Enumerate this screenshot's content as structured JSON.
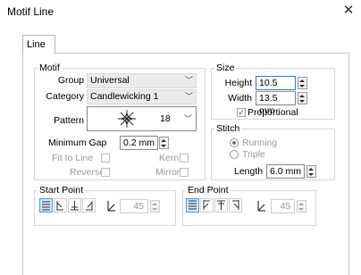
{
  "window": {
    "title": "Motif Line",
    "close_glyph": "✕"
  },
  "tabs": [
    {
      "label": "Line"
    }
  ],
  "motif": {
    "title": "Motif",
    "group_label": "Group",
    "group_value": "Universal",
    "category_label": "Category",
    "category_value": "Candlewicking 1",
    "pattern_label": "Pattern",
    "pattern_value": "18",
    "min_gap_label": "Minimum Gap",
    "min_gap_value": "0.2 mm",
    "fit_to_line_label": "Fit to Line",
    "kern_label": "Kern",
    "reverse_label": "Reverse",
    "mirror_label": "Mirror"
  },
  "size": {
    "title": "Size",
    "height_label": "Height",
    "height_value": "10.5 mm",
    "width_label": "Width",
    "width_value": "13.5 mm",
    "proportional_label": "Proportional",
    "proportional_checked": true
  },
  "stitch": {
    "title": "Stitch",
    "running_label": "Running",
    "triple_label": "Triple",
    "selected": "Running",
    "length_label": "Length",
    "length_value": "6.0 mm"
  },
  "start_point": {
    "title": "Start Point",
    "angle_value": "45",
    "icons": [
      "align-bottom-icon",
      "align-left-icon",
      "align-center-icon",
      "align-right-icon",
      "angle-icon"
    ]
  },
  "end_point": {
    "title": "End Point",
    "angle_value": "45",
    "icons": [
      "align-top-icon",
      "align-left-icon",
      "align-center-icon",
      "align-right-icon",
      "angle-icon"
    ]
  },
  "colors": {
    "accent": "#4a9ee0",
    "selected_fill": "#cfe6f7"
  }
}
